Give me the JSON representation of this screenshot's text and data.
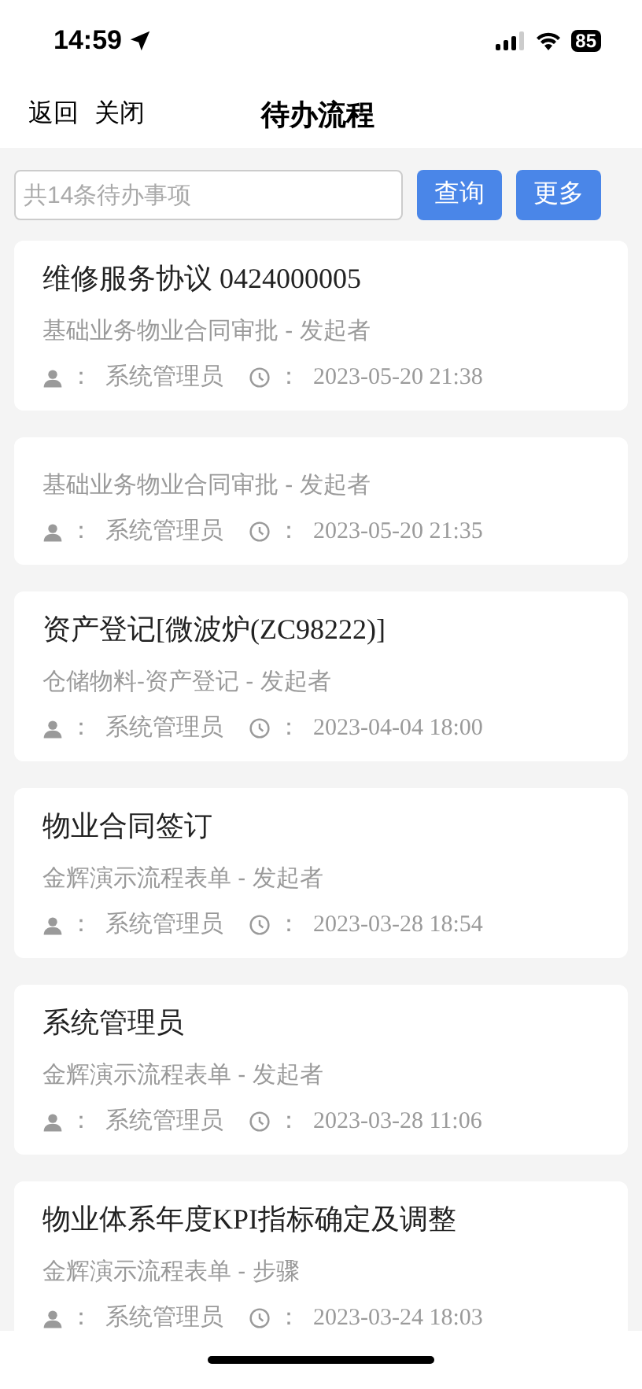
{
  "status_bar": {
    "time": "14:59",
    "battery": "85"
  },
  "nav": {
    "back": "返回",
    "close": "关闭",
    "title": "待办流程"
  },
  "search": {
    "placeholder": "共14条待办事项",
    "buttons": [
      "查询",
      "更多"
    ]
  },
  "items": [
    {
      "title": "维修服务协议 0424000005",
      "subtitle": "基础业务物业合同审批 - 发起者",
      "user": "系统管理员",
      "time": "2023-05-20 21:38"
    },
    {
      "subtitle": "基础业务物业合同审批 - 发起者",
      "user": "系统管理员",
      "time": "2023-05-20 21:35"
    },
    {
      "title": "资产登记[微波炉(ZC98222)]",
      "subtitle": "仓储物料-资产登记 - 发起者",
      "user": "系统管理员",
      "time": "2023-04-04 18:00"
    },
    {
      "title": "物业合同签订",
      "subtitle": "金辉演示流程表单 - 发起者",
      "user": "系统管理员",
      "time": "2023-03-28 18:54"
    },
    {
      "title": "系统管理员",
      "subtitle": "金辉演示流程表单 - 发起者",
      "user": "系统管理员",
      "time": "2023-03-28 11:06"
    },
    {
      "title": "物业体系年度KPI指标确定及调整",
      "subtitle": "金辉演示流程表单 - 步骤",
      "user": "系统管理员",
      "time": "2023-03-24 18:03"
    }
  ],
  "separator": "："
}
